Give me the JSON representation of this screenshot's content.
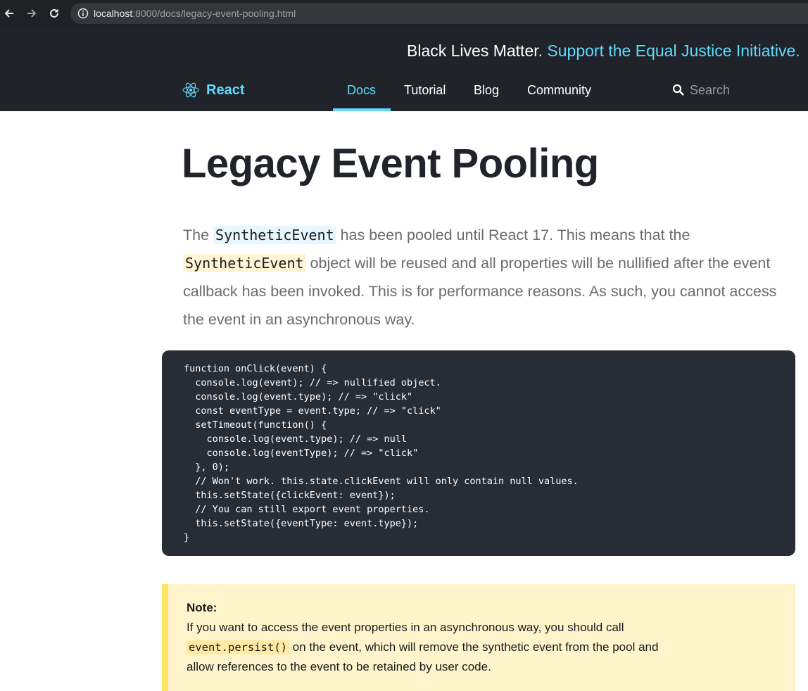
{
  "browser": {
    "url_host": "localhost",
    "url_rest": ":8000/docs/legacy-event-pooling.html"
  },
  "banner": {
    "text": "Black Lives Matter. ",
    "link": "Support the Equal Justice Initiative."
  },
  "header": {
    "logo_text": "React",
    "nav": [
      "Docs",
      "Tutorial",
      "Blog",
      "Community"
    ],
    "active_nav": "Docs",
    "search_placeholder": "Search"
  },
  "colors": {
    "accent": "#61dafb",
    "header_bg": "#20232a",
    "code_bg": "#282c34",
    "note_bg": "#fff4cc",
    "note_border": "#ffe564"
  },
  "page": {
    "title": "Legacy Event Pooling",
    "intro_1": "The ",
    "intro_code_1": "SyntheticEvent",
    "intro_2": " has been pooled until React 17. This means that the ",
    "intro_code_2": "SyntheticEvent",
    "intro_3": " object will be reused and all properties will be nullified after the event callback has been invoked. This is for performance reasons. As such, you cannot access the event in an asynchronous way.",
    "code_lines": [
      "function onClick(event) {",
      "  console.log(event); // => nullified object.",
      "  console.log(event.type); // => \"click\"",
      "  const eventType = event.type; // => \"click\"",
      "  setTimeout(function() {",
      "    console.log(event.type); // => null",
      "    console.log(eventType); // => \"click\"",
      "  }, 0);",
      "  // Won't work. this.state.clickEvent will only contain null values.",
      "  this.setState({clickEvent: event});",
      "  // You can still export event properties.",
      "  this.setState({eventType: event.type});",
      "}"
    ],
    "note": {
      "title": "Note:",
      "text_1": "If you want to access the event properties in an asynchronous way, you should call ",
      "code": "event.persist()",
      "text_2": " on the event, which will remove the synthetic event from the pool and allow references to the event to be retained by user code."
    }
  }
}
